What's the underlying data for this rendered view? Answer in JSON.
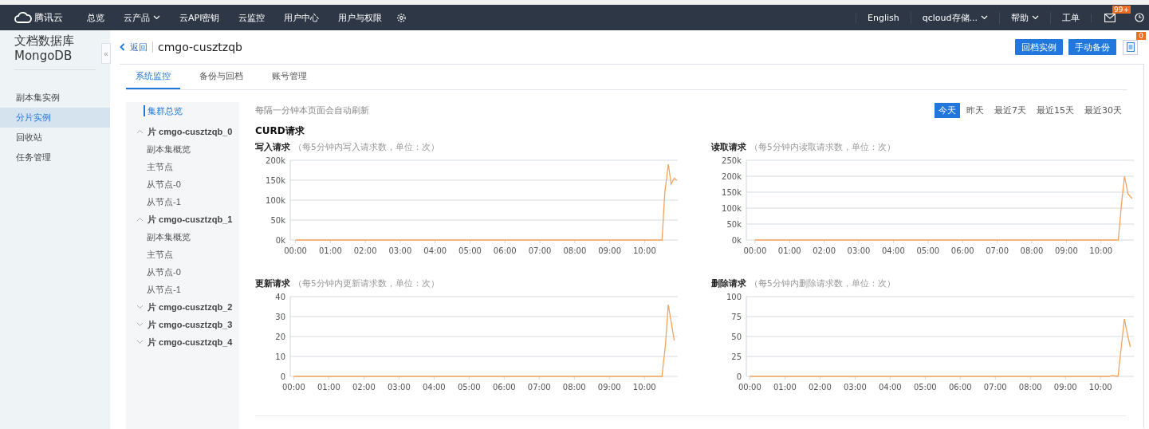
{
  "top_nav": {
    "logo": "腾讯云",
    "items": [
      {
        "label": "总览",
        "dropdown": false
      },
      {
        "label": "云产品",
        "dropdown": true
      },
      {
        "label": "云API密钥",
        "dropdown": false
      },
      {
        "label": "云监控",
        "dropdown": false
      },
      {
        "label": "用户中心",
        "dropdown": false
      },
      {
        "label": "用户与权限",
        "dropdown": false
      }
    ],
    "right_items": [
      {
        "label": "English",
        "dropdown": false
      },
      {
        "label": "qcloud存储...",
        "dropdown": true
      },
      {
        "label": "帮助",
        "dropdown": true
      },
      {
        "label": "工单",
        "dropdown": false
      }
    ],
    "mail_badge": "99+"
  },
  "sidebar": {
    "title": "文档数据库",
    "subtitle": "MongoDB",
    "collapse": "«",
    "items": [
      {
        "label": "副本集实例",
        "selected": false
      },
      {
        "label": "分片实例",
        "selected": true
      },
      {
        "label": "回收站",
        "selected": false
      },
      {
        "label": "任务管理",
        "selected": false
      }
    ]
  },
  "header": {
    "back": "返回",
    "title": "cmgo-cusztzqb",
    "buttons": [
      "回档实例",
      "手动备份"
    ],
    "doc_badge": "0"
  },
  "tabs": [
    {
      "label": "系统监控",
      "selected": true
    },
    {
      "label": "备份与回档",
      "selected": false
    },
    {
      "label": "账号管理",
      "selected": false
    }
  ],
  "tree": [
    {
      "kind": "link",
      "label": "集群总览",
      "selected": true
    },
    {
      "kind": "shard",
      "label": "片 cmgo-cusztzqb_0",
      "expanded": true,
      "selected": false,
      "children": [
        {
          "label": "副本集概览",
          "selected": false
        },
        {
          "label": "主节点",
          "selected": false
        },
        {
          "label": "从节点-0",
          "selected": false
        },
        {
          "label": "从节点-1",
          "selected": false
        }
      ]
    },
    {
      "kind": "shard",
      "label": "片 cmgo-cusztzqb_1",
      "expanded": true,
      "selected": false,
      "children": [
        {
          "label": "副本集概览",
          "selected": false
        },
        {
          "label": "主节点",
          "selected": false
        },
        {
          "label": "从节点-0",
          "selected": false
        },
        {
          "label": "从节点-1",
          "selected": false
        }
      ]
    },
    {
      "kind": "shard",
      "label": "片 cmgo-cusztzqb_2",
      "expanded": false,
      "selected": false
    },
    {
      "kind": "shard",
      "label": "片 cmgo-cusztzqb_3",
      "expanded": false,
      "selected": false
    },
    {
      "kind": "shard",
      "label": "片 cmgo-cusztzqb_4",
      "expanded": false,
      "selected": false
    }
  ],
  "refresh_note": "每隔一分钟本页面会自动刷新",
  "ranges": [
    {
      "label": "今天",
      "selected": true
    },
    {
      "label": "昨天",
      "selected": false
    },
    {
      "label": "最近7天",
      "selected": false
    },
    {
      "label": "最近15天",
      "selected": false
    },
    {
      "label": "最近30天",
      "selected": false
    }
  ],
  "section_title": "CURD请求",
  "charts": [
    {
      "title": "写入请求",
      "note": "（每5分钟内写入请求数，单位：次）",
      "chart_data": {
        "type": "line",
        "x": [
          0,
          10.5,
          10.58,
          10.68,
          10.76,
          10.85,
          10.92
        ],
        "grid": true,
        "series": [
          {
            "color": "#f5a35c",
            "values": [
              0,
              0,
              120000,
              190000,
              140000,
              155000,
              150000
            ]
          }
        ],
        "xlim": [
          -0.15,
          10.95
        ],
        "ylim": [
          0,
          200000
        ],
        "xticks": [
          {
            "value": 0,
            "label": "00:00"
          },
          {
            "value": 1,
            "label": "01:00"
          },
          {
            "value": 2,
            "label": "02:00"
          },
          {
            "value": 3,
            "label": "03:00"
          },
          {
            "value": 4,
            "label": "04:00"
          },
          {
            "value": 5,
            "label": "05:00"
          },
          {
            "value": 6,
            "label": "06:00"
          },
          {
            "value": 7,
            "label": "07:00"
          },
          {
            "value": 8,
            "label": "08:00"
          },
          {
            "value": 9,
            "label": "09:00"
          },
          {
            "value": 10,
            "label": "10:00"
          }
        ],
        "yticks": [
          {
            "value": 0,
            "label": "0k"
          },
          {
            "value": 50000,
            "label": "50k"
          },
          {
            "value": 100000,
            "label": "100k"
          },
          {
            "value": 150000,
            "label": "150k"
          },
          {
            "value": 200000,
            "label": "200k"
          }
        ]
      }
    },
    {
      "title": "读取请求",
      "note": "（每5分钟内读取请求数，单位：次）",
      "chart_data": {
        "type": "line",
        "x": [
          0,
          10.5,
          10.6,
          10.68,
          10.78,
          10.9
        ],
        "grid": true,
        "series": [
          {
            "color": "#f5a35c",
            "values": [
              0,
              0,
              120000,
              200000,
              145000,
              130000
            ]
          }
        ],
        "xlim": [
          -0.25,
          10.95
        ],
        "ylim": [
          0,
          250000
        ],
        "xticks": [
          {
            "value": 0,
            "label": "00:00"
          },
          {
            "value": 1,
            "label": "01:00"
          },
          {
            "value": 2,
            "label": "02:00"
          },
          {
            "value": 3,
            "label": "03:00"
          },
          {
            "value": 4,
            "label": "04:00"
          },
          {
            "value": 5,
            "label": "05:00"
          },
          {
            "value": 6,
            "label": "06:00"
          },
          {
            "value": 7,
            "label": "07:00"
          },
          {
            "value": 8,
            "label": "08:00"
          },
          {
            "value": 9,
            "label": "09:00"
          },
          {
            "value": 10,
            "label": "10:00"
          }
        ],
        "yticks": [
          {
            "value": 0,
            "label": "0k"
          },
          {
            "value": 50000,
            "label": "50k"
          },
          {
            "value": 100000,
            "label": "100k"
          },
          {
            "value": 150000,
            "label": "150k"
          },
          {
            "value": 200000,
            "label": "200k"
          },
          {
            "value": 250000,
            "label": "250k"
          }
        ]
      }
    },
    {
      "title": "更新请求",
      "note": "（每5分钟内更新请求数，单位：次）",
      "chart_data": {
        "type": "line",
        "x": [
          0,
          10.5,
          10.6,
          10.68,
          10.85
        ],
        "grid": true,
        "series": [
          {
            "color": "#f5a35c",
            "values": [
              0,
              0,
              16,
              36,
              18
            ]
          }
        ],
        "xlim": [
          -0.1,
          10.95
        ],
        "ylim": [
          0,
          40
        ],
        "xticks": [
          {
            "value": 0,
            "label": "00:00"
          },
          {
            "value": 1,
            "label": "01:00"
          },
          {
            "value": 2,
            "label": "02:00"
          },
          {
            "value": 3,
            "label": "03:00"
          },
          {
            "value": 4,
            "label": "04:00"
          },
          {
            "value": 5,
            "label": "05:00"
          },
          {
            "value": 6,
            "label": "06:00"
          },
          {
            "value": 7,
            "label": "07:00"
          },
          {
            "value": 8,
            "label": "08:00"
          },
          {
            "value": 9,
            "label": "09:00"
          },
          {
            "value": 10,
            "label": "10:00"
          }
        ],
        "yticks": [
          0,
          10,
          20,
          30,
          40
        ]
      }
    },
    {
      "title": "删除请求",
      "note": "（每5分钟内删除请求数，单位：次）",
      "chart_data": {
        "type": "line",
        "x": [
          0,
          10.25,
          10.32,
          10.5,
          10.6,
          10.68,
          10.78,
          10.85
        ],
        "grid": true,
        "series": [
          {
            "color": "#f5a35c",
            "values": [
              0,
              0,
              1,
              0,
              40,
              72,
              50,
              37
            ]
          }
        ],
        "xlim": [
          -0.1,
          10.95
        ],
        "ylim": [
          0,
          100
        ],
        "xticks": [
          {
            "value": 0,
            "label": "00:00"
          },
          {
            "value": 1,
            "label": "01:00"
          },
          {
            "value": 2,
            "label": "02:00"
          },
          {
            "value": 3,
            "label": "03:00"
          },
          {
            "value": 4,
            "label": "04:00"
          },
          {
            "value": 5,
            "label": "05:00"
          },
          {
            "value": 6,
            "label": "06:00"
          },
          {
            "value": 7,
            "label": "07:00"
          },
          {
            "value": 8,
            "label": "08:00"
          },
          {
            "value": 9,
            "label": "09:00"
          },
          {
            "value": 10,
            "label": "10:00"
          }
        ],
        "yticks": [
          0,
          25,
          50,
          75,
          100
        ]
      }
    }
  ]
}
